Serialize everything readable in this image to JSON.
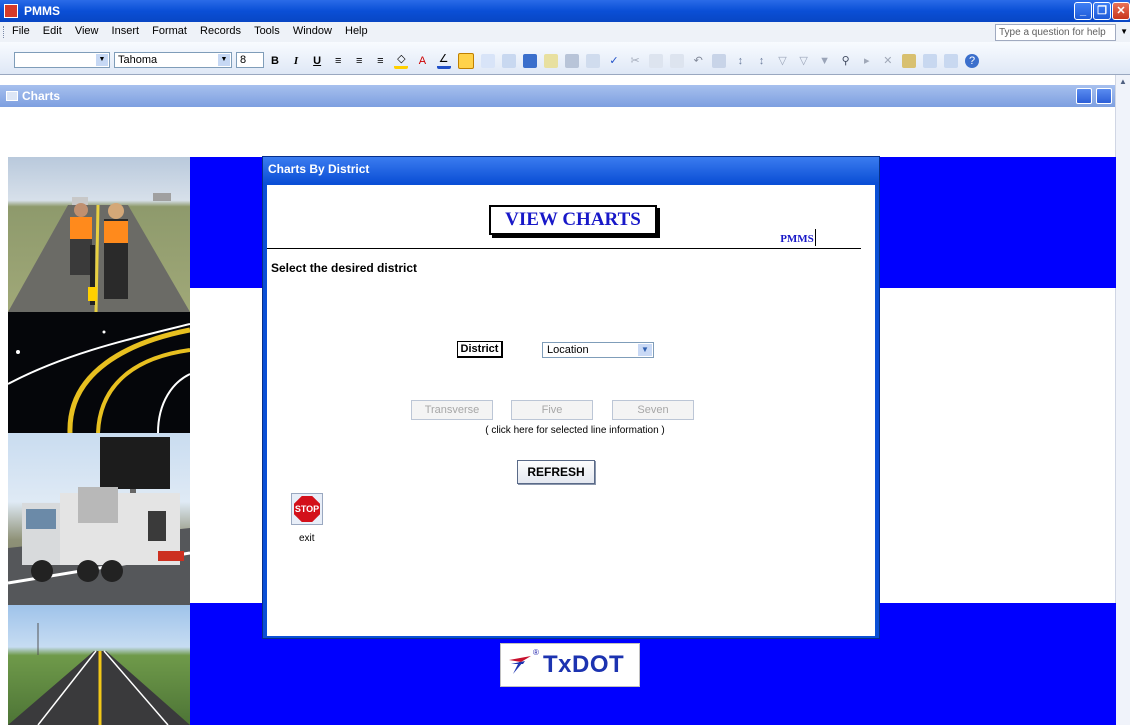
{
  "window": {
    "title": "PMMS"
  },
  "menu": {
    "items": [
      "File",
      "Edit",
      "View",
      "Insert",
      "Format",
      "Records",
      "Tools",
      "Window",
      "Help"
    ],
    "help_placeholder": "Type a question for help"
  },
  "toolbar": {
    "object_value": "",
    "font_name": "Tahoma",
    "font_size": "8"
  },
  "child": {
    "title": "Charts"
  },
  "dialog": {
    "title": "Charts By District",
    "heading": "VIEW CHARTS",
    "pmms_label": "PMMS",
    "prompt": "Select the desired district",
    "district_label": "District",
    "district_value": "Location",
    "buttons": {
      "transverse": "Transverse",
      "five": "Five",
      "seven": "Seven",
      "refresh": "REFRESH"
    },
    "hint": "( click here for selected line information )",
    "stop_text": "STOP",
    "exit_label": "exit"
  },
  "logo": {
    "text": "TxDOT",
    "registered": "®"
  },
  "colors": {
    "form_blue": "#0000ff",
    "title_blue": "#0a4fd6",
    "heading_blue": "#1818c8"
  }
}
